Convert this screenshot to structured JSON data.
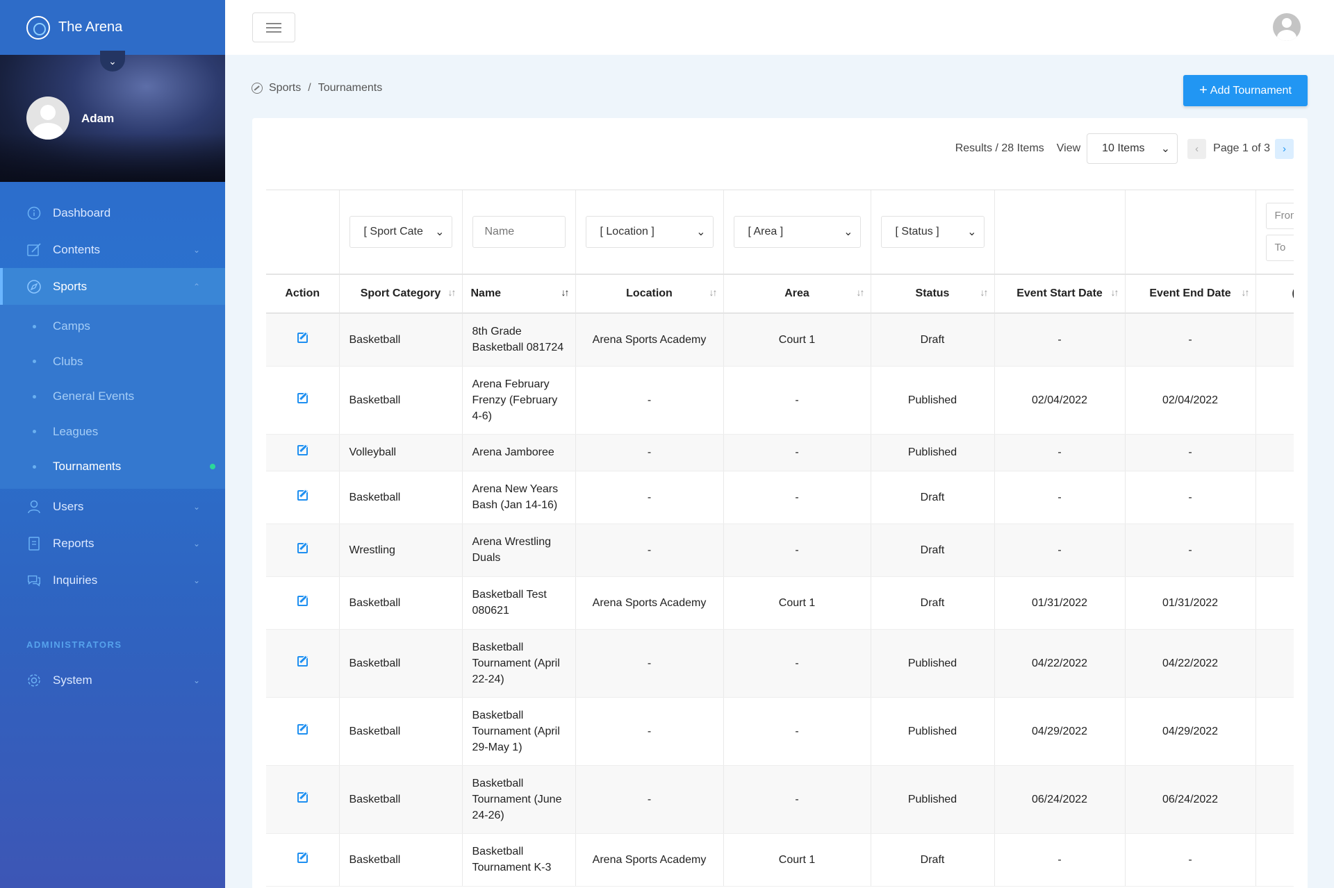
{
  "app": {
    "name": "The Arena"
  },
  "profile": {
    "name": "Adam"
  },
  "nav": {
    "items": [
      {
        "label": "Dashboard"
      },
      {
        "label": "Contents"
      },
      {
        "label": "Sports"
      }
    ],
    "sports_sub": [
      {
        "label": "Camps"
      },
      {
        "label": "Clubs"
      },
      {
        "label": "General Events"
      },
      {
        "label": "Leagues"
      },
      {
        "label": "Tournaments"
      }
    ],
    "items_after": [
      {
        "label": "Users"
      },
      {
        "label": "Reports"
      },
      {
        "label": "Inquiries"
      }
    ],
    "section_label": "ADMINISTRATORS",
    "system": {
      "label": "System"
    }
  },
  "breadcrumb": {
    "parent": "Sports",
    "separator": "/",
    "current": "Tournaments"
  },
  "add_button": {
    "label": "Add Tournament"
  },
  "results": {
    "summary": "Results / 28 Items",
    "view_label": "View",
    "view_value": "10 Items",
    "page_text": "Page 1 of 3"
  },
  "filters": {
    "sport_category": "[ Sport Cate",
    "name_placeholder": "Name",
    "location": "[ Location ]",
    "area": "[ Area ]",
    "status": "[ Status ]",
    "from": "From",
    "to": "To"
  },
  "columns": {
    "action": "Action",
    "sport_category": "Sport Category",
    "name": "Name",
    "location": "Location",
    "area": "Area",
    "status": "Status",
    "event_start": "Event Start Date",
    "event_end": "Event End Date"
  },
  "rows": [
    {
      "category": "Basketball",
      "name": "8th Grade Basketball 081724",
      "location": "Arena Sports Academy",
      "area": "Court 1",
      "status": "Draft",
      "start": "-",
      "end": "-"
    },
    {
      "category": "Basketball",
      "name": "Arena February Frenzy (February 4-6)",
      "location": "-",
      "area": "-",
      "status": "Published",
      "start": "02/04/2022",
      "end": "02/04/2022"
    },
    {
      "category": "Volleyball",
      "name": "Arena Jamboree",
      "location": "-",
      "area": "-",
      "status": "Published",
      "start": "-",
      "end": "-"
    },
    {
      "category": "Basketball",
      "name": "Arena New Years Bash (Jan 14-16)",
      "location": "-",
      "area": "-",
      "status": "Draft",
      "start": "-",
      "end": "-"
    },
    {
      "category": "Wrestling",
      "name": "Arena Wrestling Duals",
      "location": "-",
      "area": "-",
      "status": "Draft",
      "start": "-",
      "end": "-"
    },
    {
      "category": "Basketball",
      "name": "Basketball Test 080621",
      "location": "Arena Sports Academy",
      "area": "Court 1",
      "status": "Draft",
      "start": "01/31/2022",
      "end": "01/31/2022"
    },
    {
      "category": "Basketball",
      "name": "Basketball Tournament (April 22-24)",
      "location": "-",
      "area": "-",
      "status": "Published",
      "start": "04/22/2022",
      "end": "04/22/2022"
    },
    {
      "category": "Basketball",
      "name": "Basketball Tournament (April 29-May 1)",
      "location": "-",
      "area": "-",
      "status": "Published",
      "start": "04/29/2022",
      "end": "04/29/2022"
    },
    {
      "category": "Basketball",
      "name": "Basketball Tournament (June 24-26)",
      "location": "-",
      "area": "-",
      "status": "Published",
      "start": "06/24/2022",
      "end": "06/24/2022"
    },
    {
      "category": "Basketball",
      "name": "Basketball Tournament K-3",
      "location": "Arena Sports Academy",
      "area": "Court 1",
      "status": "Draft",
      "start": "-",
      "end": "-"
    }
  ]
}
